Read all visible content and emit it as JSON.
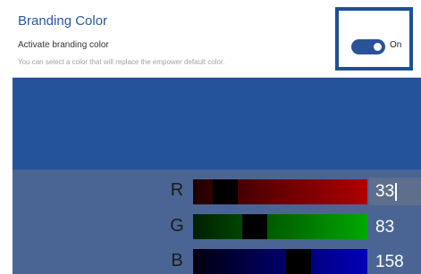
{
  "section": {
    "title": "Branding Color"
  },
  "setting": {
    "label": "Activate branding color",
    "description": "You can select a color that will replace the empower default color."
  },
  "toggle": {
    "state_label": "On",
    "enabled": true
  },
  "preview": {
    "color": "#24539c"
  },
  "channels": [
    {
      "letter": "R",
      "value": "33",
      "gradient_from": "#200000",
      "gradient_to": "#b00000",
      "level": 0.13
    },
    {
      "letter": "G",
      "value": "83",
      "gradient_from": "#001f00",
      "gradient_to": "#00a800",
      "level": 0.33
    },
    {
      "letter": "B",
      "value": "158",
      "gradient_from": "#000010",
      "gradient_to": "#0000b8",
      "level": 0.62
    }
  ],
  "colors": {
    "accent": "#2b56a5",
    "panel": "#4a6593",
    "highlight_border": "#1f4e9a"
  }
}
